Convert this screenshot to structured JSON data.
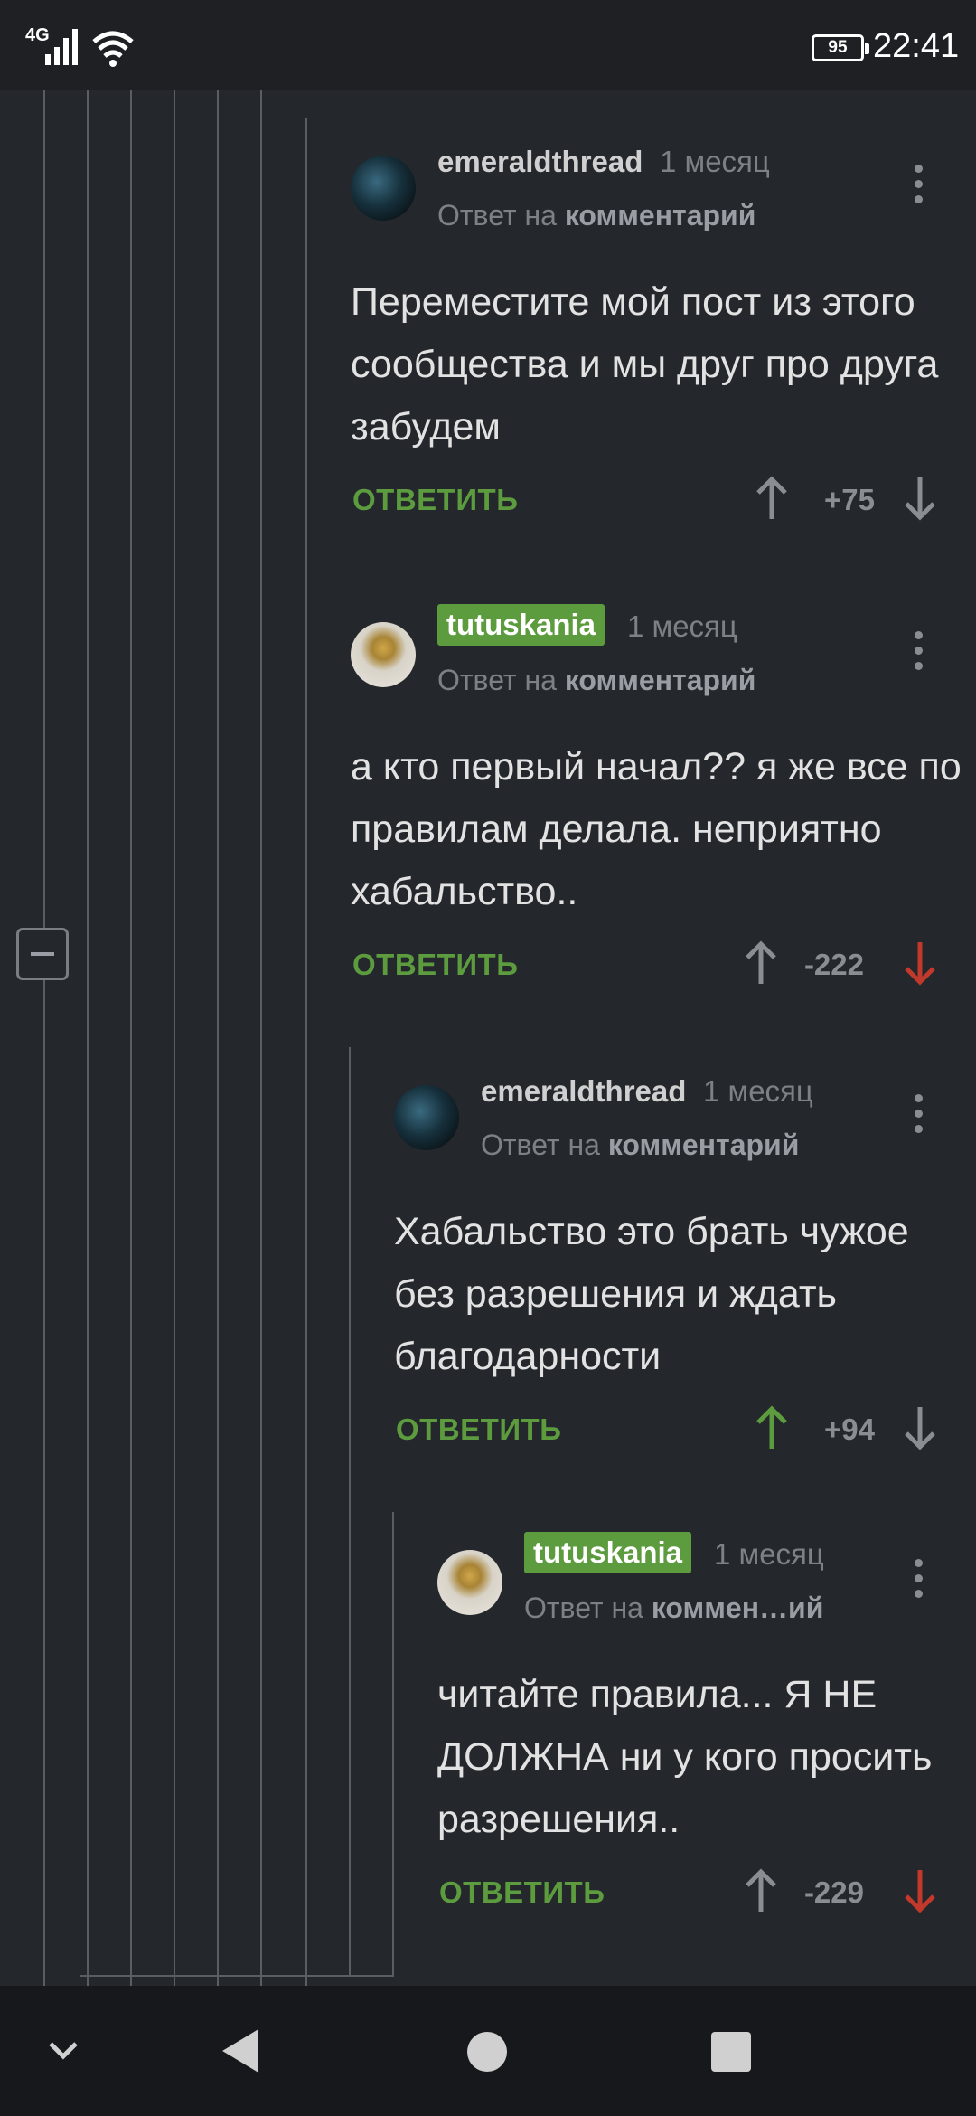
{
  "status_bar": {
    "network": "4G",
    "battery": "95",
    "time": "22:41"
  },
  "comments": [
    {
      "username": "emeraldthread",
      "badge": false,
      "time": "1 месяц",
      "reply_prefix": "Ответ на",
      "reply_target": "комментарий",
      "text": "Переместите мой пост из этого сообщества и мы друг про друга забудем",
      "reply_label": "ОТВЕТИТЬ",
      "score": "+75",
      "voted": "none"
    },
    {
      "username": "tutuskania",
      "badge": true,
      "time": "1 месяц",
      "reply_prefix": "Ответ на",
      "reply_target": "комментарий",
      "text": "а кто первый начал?? я же все по правилам делала. неприятно хабальство..",
      "reply_label": "ОТВЕТИТЬ",
      "score": "-222",
      "voted": "down"
    },
    {
      "username": "emeraldthread",
      "badge": false,
      "time": "1 месяц",
      "reply_prefix": "Ответ на",
      "reply_target": "комментарий",
      "text": "Хабальство это брать чужое без разрешения и ждать благодарности",
      "reply_label": "ОТВЕТИТЬ",
      "score": "+94",
      "voted": "up"
    },
    {
      "username": "tutuskania",
      "badge": true,
      "time": "1 месяц",
      "reply_prefix": "Ответ на",
      "reply_target": "коммен…ий",
      "text": "читайте правила... Я НЕ ДОЛЖНА ни у кого просить разрешения..",
      "reply_label": "ОТВЕТИТЬ",
      "score": "-229",
      "voted": "down"
    }
  ],
  "colors": {
    "background": "#24272b",
    "accent_green": "#5c9b3e",
    "downvote_red": "#c0392b",
    "muted": "#7d8186"
  },
  "icons": {
    "collapse": "minus-square-icon",
    "menu": "more-vert-icon",
    "upvote": "arrow-up-icon",
    "downvote": "arrow-down-icon"
  }
}
